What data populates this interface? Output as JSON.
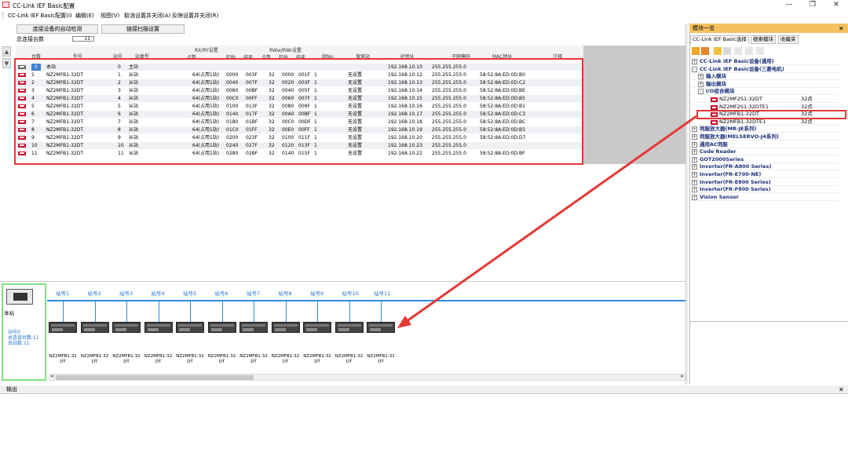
{
  "window": {
    "title": "CC-Link IEF Basic配置",
    "min_glyph": "—",
    "max_glyph": "❐",
    "close_glyph": "✕"
  },
  "menu": [
    "CC-Link IEF Basic配置(I)",
    "编辑(E)",
    "视图(V)",
    "取消设置并关闭(A)",
    "反映设置并关闭(R)"
  ],
  "toolbar": {
    "autodetect_label": "连接设备的自动检测",
    "link_scan_label": "链接扫描设置",
    "total_label": "总连接台数",
    "total_value": "11"
  },
  "grid": {
    "headers": {
      "count": "台数",
      "model": "型号",
      "station": "站号",
      "station_type": "站类型",
      "rxry": "RX/RY设置",
      "points": "点数",
      "start": "起始",
      "end": "结束",
      "rwrw": "RWw/RWr设置",
      "group": "组No.",
      "reserved": "保留站",
      "ip": "IP地址",
      "subnet": "子网掩码",
      "mac": "MAC地址",
      "comment": "注释"
    },
    "rows": [
      [
        "0",
        "本站",
        "0",
        "主站",
        "",
        "",
        "",
        "",
        "",
        "",
        "",
        "192.168.10.10",
        "255.255.255.0",
        ""
      ],
      [
        "1",
        "NZ2MFB1-32DT",
        "1",
        "从站",
        "64(占用1站)",
        "0000",
        "003F",
        "32",
        "0000",
        "001F",
        "1",
        "无设置",
        "192.168.10.12",
        "255.255.255.0",
        "58:52:8A:ED:0D:B0"
      ],
      [
        "2",
        "NZ2MFB1-32DT",
        "2",
        "从站",
        "64(占用1站)",
        "0040",
        "007F",
        "32",
        "0020",
        "003F",
        "1",
        "无设置",
        "192.168.10.13",
        "255.255.255.0",
        "58:52:8A:ED:0D:C2"
      ],
      [
        "3",
        "NZ2MFB1-32DT",
        "3",
        "从站",
        "64(占用1站)",
        "0080",
        "00BF",
        "32",
        "0040",
        "005F",
        "1",
        "无设置",
        "192.168.10.14",
        "255.255.255.0",
        "58:52:8A:ED:0D:BE"
      ],
      [
        "4",
        "NZ2MFB1-32DT",
        "4",
        "从站",
        "64(占用1站)",
        "00C0",
        "00FF",
        "32",
        "0060",
        "007F",
        "1",
        "无设置",
        "192.168.10.15",
        "255.255.255.0",
        "58:52:8A:ED:0D:B5"
      ],
      [
        "5",
        "NZ2MFB1-32DT",
        "5",
        "从站",
        "64(占用1站)",
        "0100",
        "013F",
        "32",
        "0080",
        "009F",
        "1",
        "无设置",
        "192.168.10.16",
        "255.255.255.0",
        "58:52:8A:ED:0D:B1"
      ],
      [
        "6",
        "NZ2MFB1-32DT",
        "6",
        "从站",
        "64(占用1站)",
        "0140",
        "017F",
        "32",
        "00A0",
        "00BF",
        "1",
        "无设置",
        "192.168.10.17",
        "255.255.255.0",
        "58:52:8A:ED:0D:C3"
      ],
      [
        "7",
        "NZ2MFB1-32DT",
        "7",
        "从站",
        "64(占用1站)",
        "0180",
        "01BF",
        "32",
        "00C0",
        "00DF",
        "1",
        "无设置",
        "192.168.10.18",
        "255.255.255.0",
        "58:52:8A:ED:0D:BC"
      ],
      [
        "8",
        "NZ2MFB1-32DT",
        "8",
        "从站",
        "64(占用1站)",
        "01C0",
        "01FF",
        "32",
        "00E0",
        "00FF",
        "1",
        "无设置",
        "192.168.10.19",
        "255.255.255.0",
        "58:52:8A:ED:0D:B3"
      ],
      [
        "9",
        "NZ2MFB1-32DT",
        "9",
        "从站",
        "64(占用1站)",
        "0200",
        "023F",
        "32",
        "0100",
        "011F",
        "1",
        "无设置",
        "192.168.10.20",
        "255.255.255.0",
        "58:52:8A:ED:0D:D7"
      ],
      [
        "10",
        "NZ2MFB1-32DT",
        "10",
        "从站",
        "64(占用1站)",
        "0240",
        "027F",
        "32",
        "0120",
        "013F",
        "1",
        "无设置",
        "192.168.10.23",
        "255.255.255.0",
        ""
      ],
      [
        "11",
        "NZ2MFB1-32DT",
        "11",
        "从站",
        "64(占用1站)",
        "0280",
        "02BF",
        "32",
        "0140",
        "015F",
        "1",
        "无设置",
        "192.168.10.22",
        "255.255.255.0",
        "58:52:8A:ED:0D:BF"
      ]
    ]
  },
  "network": {
    "master_label": "本站",
    "master_info": [
      "站号0",
      "总连接台数:11",
      "总站数:11"
    ],
    "station_labels": [
      "站号1",
      "站号2",
      "站号3",
      "站号4",
      "站号5",
      "站号6",
      "站号7",
      "站号8",
      "站号9",
      "站号10",
      "站号11"
    ],
    "device_name_line1": "NZ2MFB1-32",
    "device_name_line2": "DT"
  },
  "output": {
    "title": "输出"
  },
  "module_panel": {
    "title": "模块一览",
    "tabs": [
      "CC-Link IEF Basic选择",
      "搜索模块",
      "收藏夹"
    ],
    "tree": [
      {
        "label": "CC-Link IEF Basic设备(通用)",
        "sign": "+",
        "level": 0
      },
      {
        "label": "CC-Link IEF Basic设备(三菱电机)",
        "sign": "-",
        "level": 0
      },
      {
        "label": "输入模块",
        "sign": "+",
        "level": 1
      },
      {
        "label": "输出模块",
        "sign": "+",
        "level": 1
      },
      {
        "label": "I/O组合模块",
        "sign": "-",
        "level": 1
      },
      {
        "label": "NZ2MF2S1-32DT",
        "points": "32点",
        "level": 2
      },
      {
        "label": "NZ2MF2S1-32DTE1",
        "points": "32点",
        "level": 2
      },
      {
        "label": "NZ2MFB1-32DT",
        "points": "32点",
        "level": 2,
        "highlight": true
      },
      {
        "label": "NZ2MFB1-32DTE1",
        "points": "32点",
        "level": 2
      },
      {
        "label": "伺服放大器(MR-JE系列)",
        "sign": "+",
        "level": 0
      },
      {
        "label": "伺服放大器(MELSERVO-J4系列)",
        "sign": "+",
        "level": 0
      },
      {
        "label": "通用AC伺服",
        "sign": "+",
        "level": 0
      },
      {
        "label": "Code Reader",
        "sign": "+",
        "level": 0
      },
      {
        "label": "GOT2000Series",
        "sign": "+",
        "level": 0
      },
      {
        "label": "Inverter(FR-A800 Series)",
        "sign": "+",
        "level": 0
      },
      {
        "label": "Inverter(FR-E700-NE)",
        "sign": "+",
        "level": 0
      },
      {
        "label": "Inverter(FR-E800 Series)",
        "sign": "+",
        "level": 0
      },
      {
        "label": "Inverter(FR-F800 Series)",
        "sign": "+",
        "level": 0
      },
      {
        "label": "Vision Sensor",
        "sign": "+",
        "level": 0
      }
    ]
  },
  "colors": {
    "accent": "#2d8be0",
    "highlight": "#e53935",
    "panel_header": "#f5c15f",
    "tree_text": "#1a2f7a",
    "selection": "#cde2fb"
  },
  "icons": [
    "app-icon",
    "device-icon",
    "scroll-up-icon",
    "scroll-down-icon",
    "master-plc-icon",
    "slave-device-icon"
  ]
}
